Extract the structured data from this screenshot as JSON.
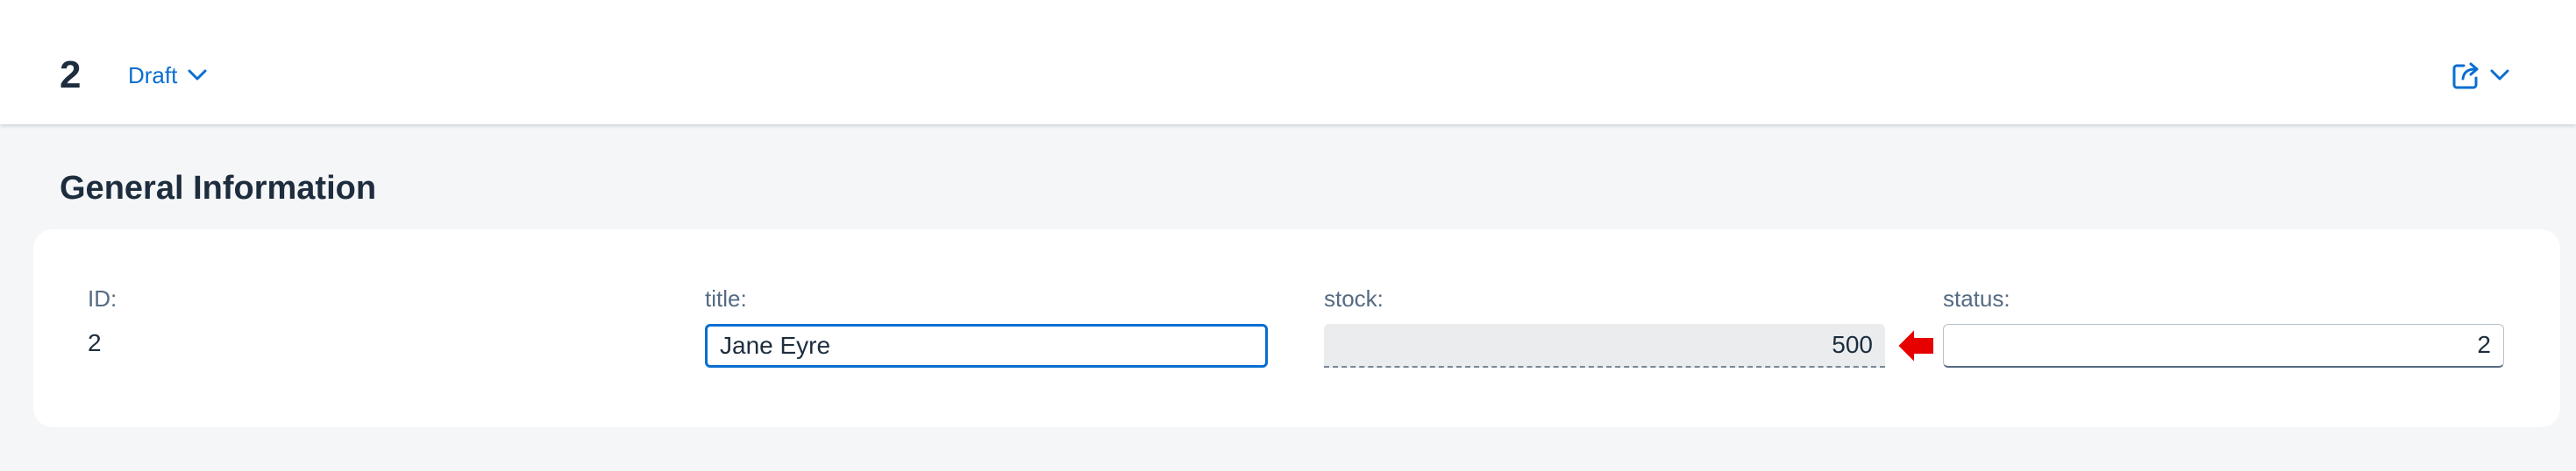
{
  "header": {
    "object_title": "2",
    "draft_label": "Draft",
    "share_icon": "share-icon",
    "menu_icon": "chevron-down-icon"
  },
  "section": {
    "title": "General Information"
  },
  "fields": {
    "id": {
      "label": "ID:",
      "value": "2"
    },
    "title": {
      "label": "title:",
      "value": "Jane Eyre"
    },
    "stock": {
      "label": "stock:",
      "value": "500"
    },
    "status": {
      "label": "status:",
      "value": "2"
    }
  },
  "colors": {
    "accent": "#0a6ed1",
    "text": "#1d2d3e",
    "label": "#556b82",
    "background": "#f5f6f7",
    "annotation_arrow": "#e60000"
  }
}
